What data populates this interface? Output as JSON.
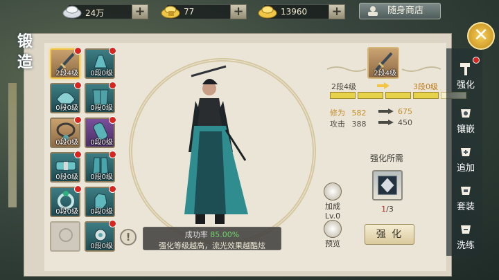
{
  "currency": [
    {
      "name": "silver",
      "value": "24万"
    },
    {
      "name": "gold-ingot-bound",
      "value": "77"
    },
    {
      "name": "gold-ingot",
      "value": "13960"
    }
  ],
  "shop_label": "随身商店",
  "panel_title": [
    "锻",
    "造"
  ],
  "slots": [
    {
      "level": "2段4级",
      "selected": true,
      "dot": true
    },
    {
      "level": "0段0级",
      "selected": false,
      "dot": true
    },
    {
      "level": "0段0级",
      "selected": false,
      "dot": true
    },
    {
      "level": "0段0级",
      "selected": false,
      "dot": true
    },
    {
      "level": "0段0级",
      "selected": false,
      "dot": true
    },
    {
      "level": "0段0级",
      "selected": false,
      "dot": true
    },
    {
      "level": "0段0级",
      "selected": false,
      "dot": true
    },
    {
      "level": "0段0级",
      "selected": false,
      "dot": true
    },
    {
      "level": "0段0级",
      "selected": false,
      "dot": true
    },
    {
      "level": "0段0级",
      "selected": false,
      "dot": true
    },
    {
      "level": "",
      "selected": false,
      "dot": false
    },
    {
      "level": "0段0级",
      "selected": false,
      "dot": true
    }
  ],
  "selected_item_level": "2段4级",
  "level_from": "2段4级",
  "level_to": "3段0级",
  "stats": [
    {
      "label": "修为",
      "from": "582",
      "to": "675"
    },
    {
      "label": "攻击",
      "from": "388",
      "to": "450"
    }
  ],
  "progress_filled": 4,
  "progress_total": 5,
  "req_title": "强化所需",
  "req_count_have": "1",
  "req_count_sep": "/3",
  "strengthen_button": "强 化",
  "addon_label": "加成",
  "addon_level": "Lv.0",
  "preview_label": "预览",
  "success_label": "成功率",
  "success_value": "85.00%",
  "success_hint": "强化等级越高，流光效果越酷炫",
  "side_tabs": [
    {
      "label": "强化",
      "active": true
    },
    {
      "label": "镶嵌",
      "active": false
    },
    {
      "label": "追加",
      "active": false
    },
    {
      "label": "套装",
      "active": false
    },
    {
      "label": "洗练",
      "active": false
    }
  ],
  "colors": {
    "accent_gold": "#f1c546",
    "green": "#6fd86a",
    "red_dot": "#d7261f"
  }
}
